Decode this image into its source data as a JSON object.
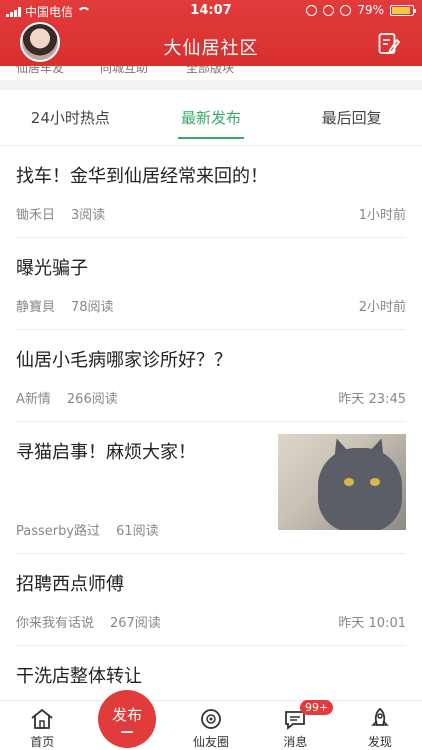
{
  "status_bar": {
    "carrier": "中国电信",
    "time": "14:07",
    "battery": "79%"
  },
  "header": {
    "title": "大仙居社区",
    "icons": [
      "avatar",
      "edit-icon"
    ]
  },
  "categories": [
    "仙居车友",
    "同城互助",
    "全部版块"
  ],
  "tabs": [
    {
      "label": "24小时热点",
      "active": false
    },
    {
      "label": "最新发布",
      "active": true
    },
    {
      "label": "最后回复",
      "active": false
    }
  ],
  "posts": [
    {
      "title": "找车！金华到仙居经常来回的！",
      "author": "锄禾日",
      "reads": "3阅读",
      "time": "1小时前"
    },
    {
      "title": "曝光骗子",
      "author": "静寶貝",
      "reads": "78阅读",
      "time": "2小时前"
    },
    {
      "title": "仙居小毛病哪家诊所好？？",
      "author": "A新情",
      "reads": "266阅读",
      "time": "昨天 23:45"
    },
    {
      "title": "寻猫启事！麻烦大家！",
      "author": "Passerby路过",
      "reads": "61阅读",
      "time": ""
    },
    {
      "title": "招聘西点师傅",
      "author": "你来我有话说",
      "reads": "267阅读",
      "time": "昨天 10:01"
    },
    {
      "title": "干洗店整体转让",
      "author": "",
      "reads": "",
      "time": ""
    }
  ],
  "bottom_nav": {
    "home": "首页",
    "publish": "发布",
    "friends": "仙友圈",
    "messages": "消息",
    "messages_badge": "99+",
    "discover": "发现"
  },
  "colors": {
    "brand_red": "#e23b3b",
    "active_tab_green": "#3aa86b"
  }
}
